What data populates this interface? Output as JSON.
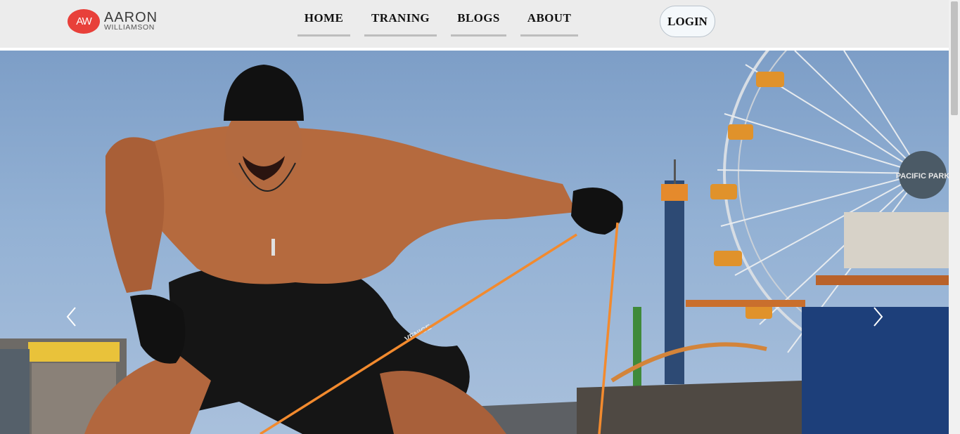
{
  "brand": {
    "monogram": "AW",
    "name": "AARON",
    "subname": "WILLIAMSON",
    "accent_color": "#e8403a"
  },
  "nav": {
    "items": [
      {
        "label": "HOME"
      },
      {
        "label": "TRANING"
      },
      {
        "label": "BLOGS"
      },
      {
        "label": "ABOUT"
      }
    ],
    "login_label": "LOGIN"
  },
  "hero": {
    "image_subject": "shirtless bodybuilder in black cap pulling orange resistance bands on a pier beside a ferris wheel",
    "ferris_wheel_sign": "PACIFIC PARK",
    "shorts_text": "VENICE",
    "prev_icon": "chevron-left-icon",
    "next_icon": "chevron-right-icon"
  }
}
